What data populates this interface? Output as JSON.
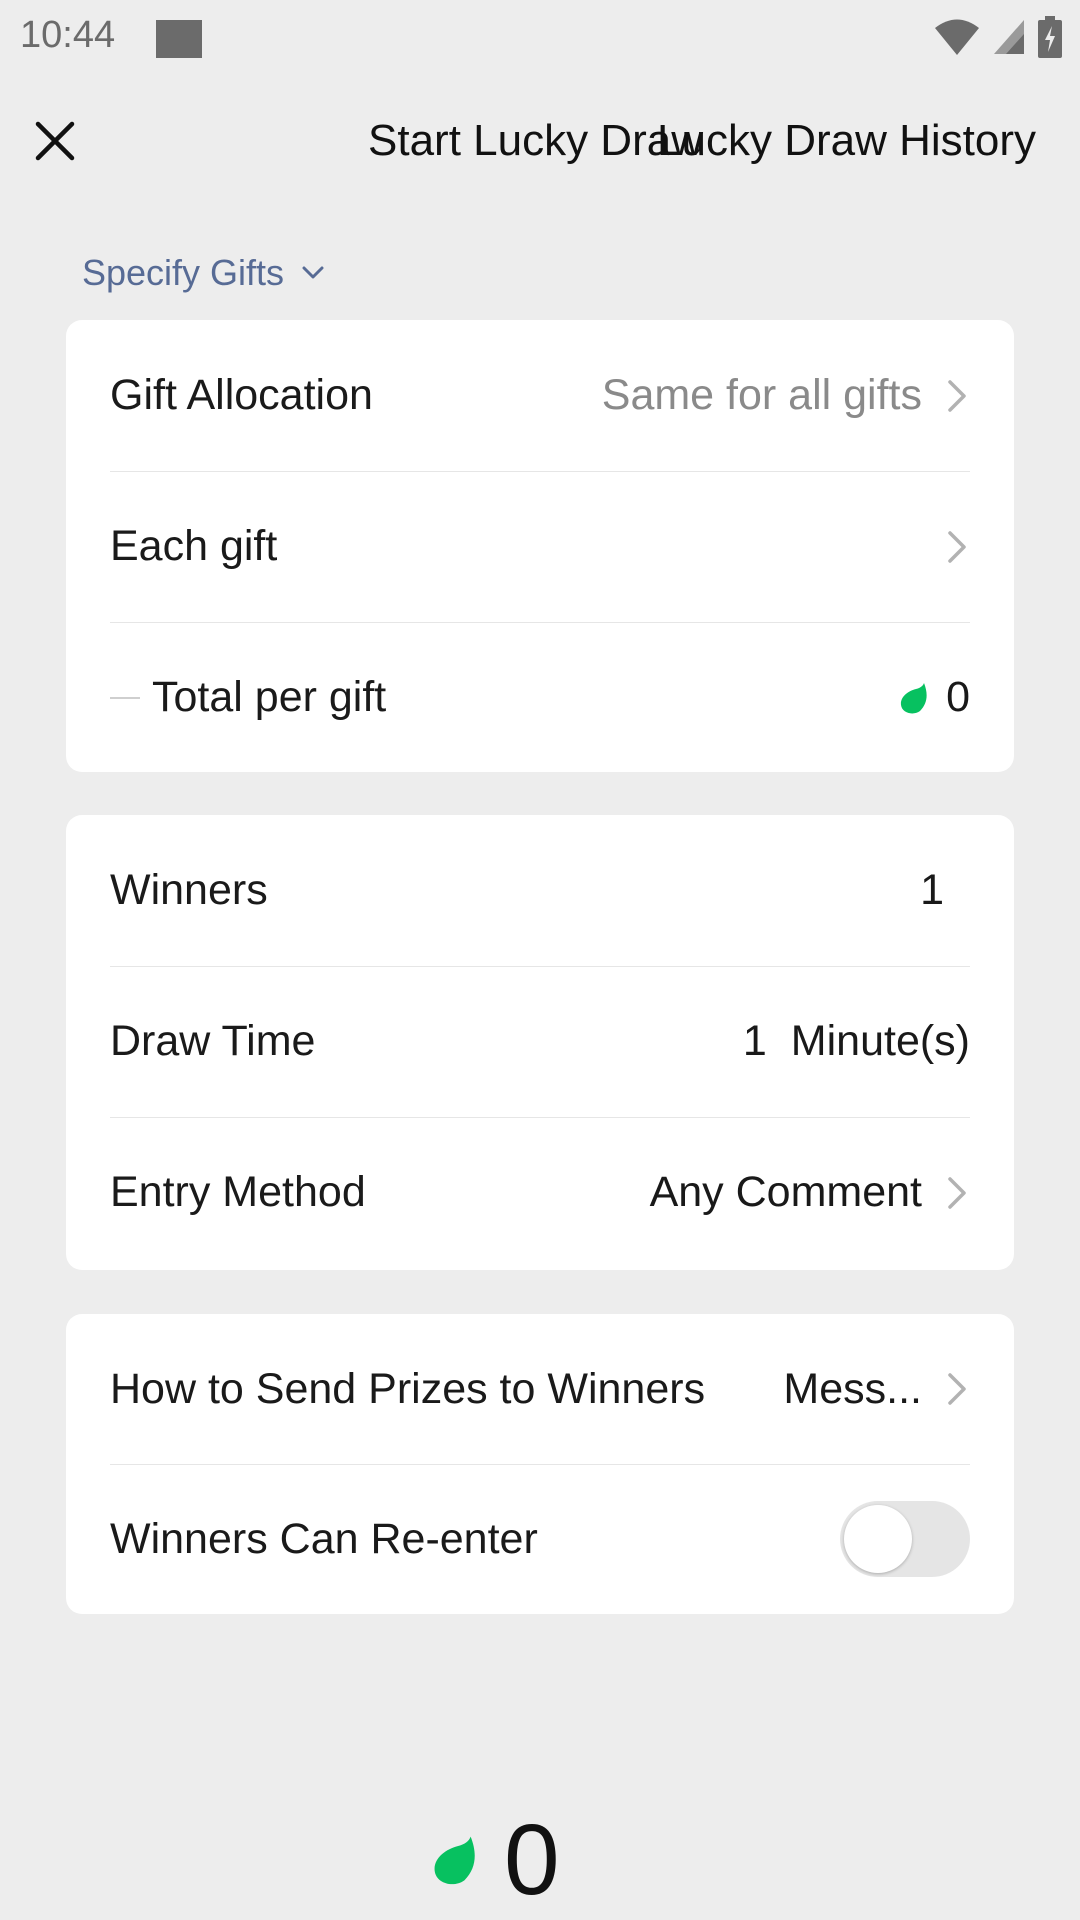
{
  "status_bar": {
    "time": "10:44"
  },
  "header": {
    "title": "Start Lucky Draw",
    "history_label": "Lucky Draw History"
  },
  "specify_gifts": {
    "label": "Specify Gifts"
  },
  "gift_card": {
    "allocation": {
      "label": "Gift Allocation",
      "value": "Same for all gifts"
    },
    "each_gift": {
      "label": "Each gift"
    },
    "total": {
      "label": "Total per gift",
      "value": "0"
    }
  },
  "draw_card": {
    "winners": {
      "label": "Winners",
      "value": "1"
    },
    "draw_time": {
      "label": "Draw Time",
      "value": "1",
      "unit": "Minute(s)"
    },
    "entry_method": {
      "label": "Entry Method",
      "value": "Any Comment"
    }
  },
  "prize_card": {
    "send_prizes": {
      "label": "How to Send Prizes to Winners",
      "value": "Mess..."
    },
    "re_enter": {
      "label": "Winners Can Re-enter",
      "enabled": false
    }
  },
  "footer": {
    "total": "0"
  },
  "colors": {
    "accent_green": "#07c160",
    "link_blue": "#576b95",
    "background": "#ededed"
  }
}
